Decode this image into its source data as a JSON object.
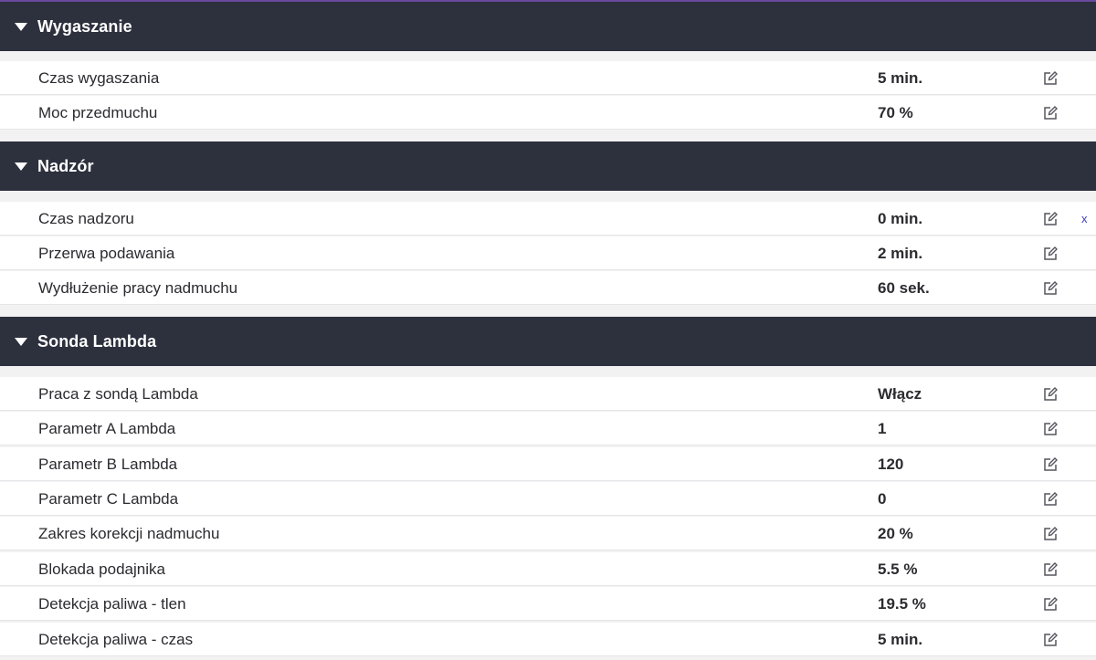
{
  "sections": [
    {
      "title": "Wygaszanie",
      "rows": [
        {
          "label": "Czas wygaszania",
          "value": "5 min."
        },
        {
          "label": "Moc przedmuchu",
          "value": "70 %"
        }
      ]
    },
    {
      "title": "Nadzór",
      "rows": [
        {
          "label": "Czas nadzoru",
          "value": "0 min.",
          "close": "x"
        },
        {
          "label": "Przerwa podawania",
          "value": "2 min."
        },
        {
          "label": "Wydłużenie pracy nadmuchu",
          "value": "60 sek."
        }
      ]
    },
    {
      "title": "Sonda Lambda",
      "rows": [
        {
          "label": "Praca z sondą Lambda",
          "value": "Włącz"
        },
        {
          "label": "Parametr A Lambda",
          "value": "1"
        },
        {
          "label": "Parametr B Lambda",
          "value": "120"
        },
        {
          "label": "Parametr C Lambda",
          "value": "0"
        },
        {
          "label": "Zakres korekcji nadmuchu",
          "value": "20 %"
        },
        {
          "label": "Blokada podajnika",
          "value": "5.5 %"
        },
        {
          "label": "Detekcja paliwa - tlen",
          "value": "19.5 %"
        },
        {
          "label": "Detekcja paliwa - czas",
          "value": "5 min."
        }
      ]
    }
  ],
  "icons": {
    "header": "caret-down-icon",
    "row_action": "edit-icon"
  },
  "colors": {
    "header_bg": "#2d303d",
    "accent_line": "#6a4a9c",
    "close_link": "#3b3fbf"
  }
}
